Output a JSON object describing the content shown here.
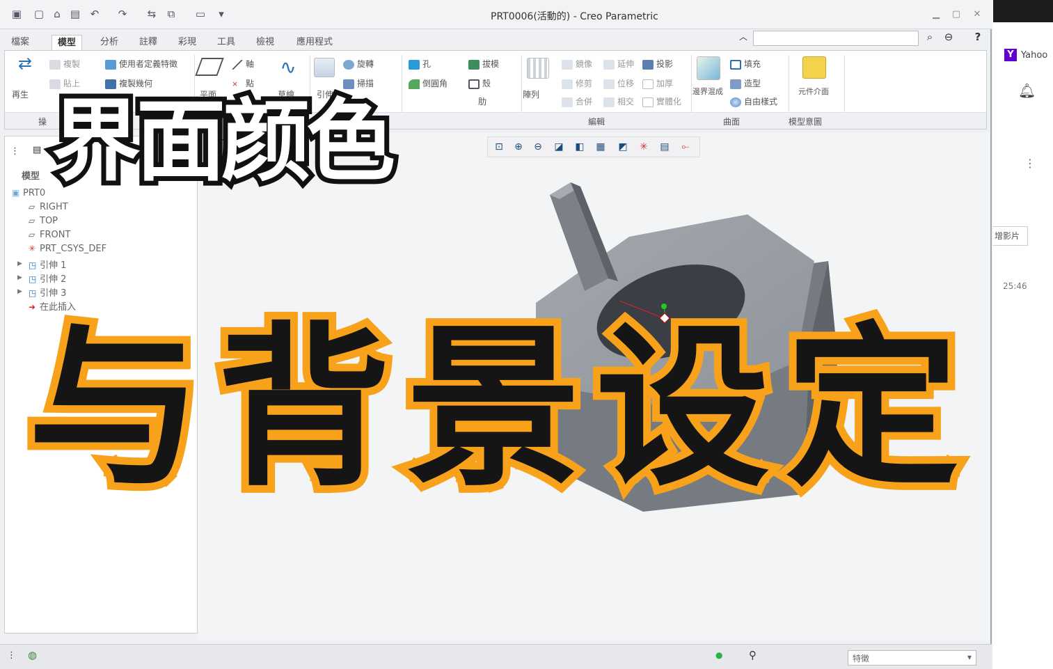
{
  "window": {
    "title": "PRT0006(活動的) - Creo Parametric"
  },
  "tabs": [
    "檔案",
    "模型",
    "分析",
    "註釋",
    "彩現",
    "工具",
    "檢視",
    "應用程式"
  ],
  "ribbon": {
    "operations": {
      "regen": "再生",
      "copy": "複製",
      "paste": "貼上",
      "udf": "使用者定義特徵",
      "copy_geom": "複製幾何"
    },
    "datum": {
      "plane": "平面",
      "axis": "軸",
      "point": "點",
      "sketch": "草繪"
    },
    "shapes": {
      "revolve": "旋轉",
      "sweep": "掃描",
      "extrude": "引伸"
    },
    "engineering": {
      "hole": "孔",
      "round": "倒圓角",
      "draft": "拔模",
      "shell": "殼",
      "rib": "肋"
    },
    "editing": {
      "pattern": "陣列",
      "mirror": "鏡像",
      "trim": "修剪",
      "merge": "合併",
      "extend": "延伸",
      "offset": "位移",
      "intersect": "相交",
      "project": "投影",
      "thicken": "加厚",
      "solidify": "實體化"
    },
    "surfaces": {
      "boundary_blend": "邊界混成",
      "fill": "填充",
      "style": "造型",
      "freestyle": "自由樣式"
    },
    "intent": {
      "component_interface": "元件介面"
    },
    "group_labels": {
      "operations": "操",
      "editing": "編輯",
      "surfaces": "曲面",
      "intent": "模型意圖"
    }
  },
  "model_tree": {
    "header": "模型",
    "items": [
      {
        "label": "PRT0"
      },
      {
        "label": "RIGHT"
      },
      {
        "label": "TOP"
      },
      {
        "label": "FRONT"
      },
      {
        "label": "PRT_CSYS_DEF"
      },
      {
        "label": "引伸 1"
      },
      {
        "label": "引伸 2"
      },
      {
        "label": "引伸 3"
      },
      {
        "label": "在此插入"
      }
    ]
  },
  "status": {
    "filter_value": "特徵"
  },
  "right_panel": {
    "yahoo": "Yahoo",
    "snapshot": "增影片",
    "time": "25:46"
  },
  "overlay": {
    "line1": "界面颜色",
    "line2": "与背景设定"
  },
  "colors": {
    "accent_orange": "#f7a21a",
    "model_gray": "#8d9299",
    "title_text_outline": "#111111"
  }
}
